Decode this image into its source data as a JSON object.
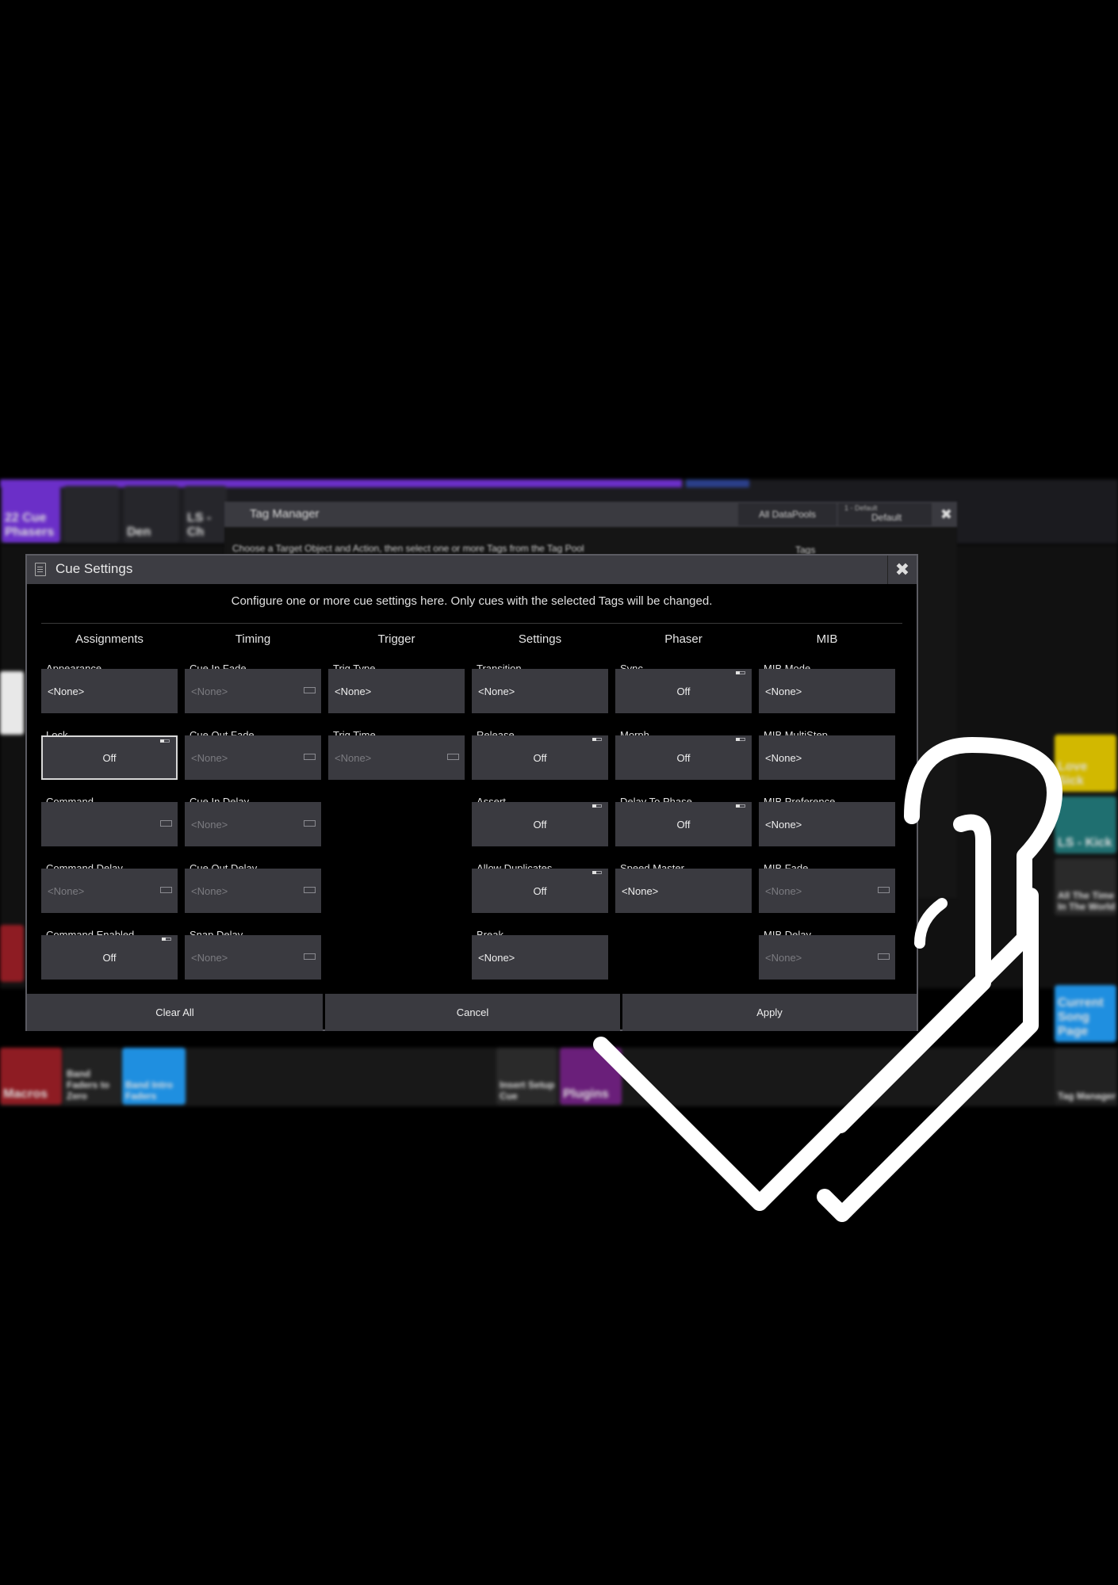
{
  "background": {
    "top_tiles": [
      {
        "label": "22 Cue Phasers",
        "color": "#6b2fc8"
      },
      {
        "label": "LS - Ch",
        "color": "#26262b"
      },
      {
        "label": "Den",
        "color": "#26262b"
      }
    ],
    "bottom_tiles": [
      {
        "label": "Macros",
        "color": "#8e1c23"
      },
      {
        "label": "Band Faders to Zero",
        "color": "#222"
      },
      {
        "label": "Band Intro Faders",
        "color": "#1f8fe0"
      },
      {
        "label": "Insert Setup Cue",
        "color": "#2a2a2a"
      },
      {
        "label": "Plugins",
        "color": "#6a1f7a"
      },
      {
        "label": "Tag Manager",
        "color": "#222"
      }
    ],
    "right_tiles": [
      {
        "label": "Love Sick",
        "color": "#d2b800"
      },
      {
        "label": "LS - Kick",
        "color": "#1f6f70"
      },
      {
        "label": "All The Time In The World",
        "color": "#2a2a2a"
      },
      {
        "label": "Current Song Page",
        "color": "#1f8fe0"
      }
    ]
  },
  "tag_manager": {
    "title": "Tag Manager",
    "datapools_label": "All DataPools",
    "pool_small": "1 - Default",
    "pool_big": "Default",
    "hint": "Choose a Target Object and Action, then select one or more Tags from the Tag Pool",
    "tags_header": "Tags"
  },
  "dialog": {
    "title": "Cue Settings",
    "description": "Configure one or more cue settings here. Only cues with the selected Tags will be changed.",
    "columns": [
      {
        "header": "Assignments",
        "fields": [
          {
            "label": "Appearance",
            "value": "<None>",
            "kind": "value"
          },
          {
            "label": "Lock",
            "value": "Off",
            "kind": "toggle",
            "selected": true
          },
          {
            "label": "Command",
            "value": "",
            "kind": "input"
          },
          {
            "label": "Command Delay",
            "value": "<None>",
            "kind": "input"
          },
          {
            "label": "Command Enabled",
            "value": "Off",
            "kind": "toggle"
          }
        ]
      },
      {
        "header": "Timing",
        "fields": [
          {
            "label": "Cue In Fade",
            "value": "<None>",
            "kind": "input"
          },
          {
            "label": "Cue Out Fade",
            "value": "<None>",
            "kind": "input"
          },
          {
            "label": "Cue In Delay",
            "value": "<None>",
            "kind": "input"
          },
          {
            "label": "Cue Out Delay",
            "value": "<None>",
            "kind": "input"
          },
          {
            "label": "Snap Delay",
            "value": "<None>",
            "kind": "input"
          }
        ]
      },
      {
        "header": "Trigger",
        "fields": [
          {
            "label": "Trig Type",
            "value": "<None>",
            "kind": "value"
          },
          {
            "label": "Trig Time",
            "value": "<None>",
            "kind": "input"
          }
        ]
      },
      {
        "header": "Settings",
        "fields": [
          {
            "label": "Transition",
            "value": "<None>",
            "kind": "value"
          },
          {
            "label": "Release",
            "value": "Off",
            "kind": "toggle"
          },
          {
            "label": "Assert",
            "value": "Off",
            "kind": "toggle"
          },
          {
            "label": "Allow Duplicates",
            "value": "Off",
            "kind": "toggle"
          },
          {
            "label": "Break",
            "value": "<None>",
            "kind": "value"
          }
        ]
      },
      {
        "header": "Phaser",
        "fields": [
          {
            "label": "Sync",
            "value": "Off",
            "kind": "toggle"
          },
          {
            "label": "Morph",
            "value": "Off",
            "kind": "toggle"
          },
          {
            "label": "Delay To Phase",
            "value": "Off",
            "kind": "toggle"
          },
          {
            "label": "Speed Master",
            "value": "<None>",
            "kind": "value"
          }
        ]
      },
      {
        "header": "MIB",
        "fields": [
          {
            "label": "MIB Mode",
            "value": "<None>",
            "kind": "value"
          },
          {
            "label": "MIB MultiStep",
            "value": "<None>",
            "kind": "value"
          },
          {
            "label": "MIB Preference",
            "value": "<None>",
            "kind": "value"
          },
          {
            "label": "MIB Fade",
            "value": "<None>",
            "kind": "input"
          },
          {
            "label": "MIB Delay",
            "value": "<None>",
            "kind": "input"
          }
        ]
      }
    ],
    "buttons": {
      "clear_all": "Clear All",
      "cancel": "Cancel",
      "apply": "Apply"
    }
  }
}
